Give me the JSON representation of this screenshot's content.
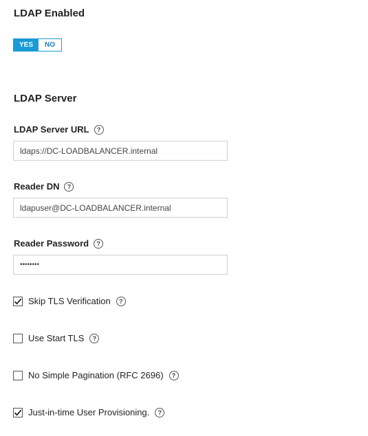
{
  "ldap_enabled": {
    "title": "LDAP Enabled",
    "toggle": {
      "yes_label": "YES",
      "no_label": "NO",
      "selected": "YES"
    }
  },
  "ldap_server": {
    "title": "LDAP Server",
    "server_url": {
      "label": "LDAP Server URL",
      "value": "ldaps://DC-LOADBALANCER.internal"
    },
    "reader_dn": {
      "label": "Reader DN",
      "value": "ldapuser@DC-LOADBALANCER.internal"
    },
    "reader_password": {
      "label": "Reader Password",
      "value": "••••••••"
    }
  },
  "options": [
    {
      "label": "Skip TLS Verification",
      "checked": true
    },
    {
      "label": "Use Start TLS",
      "checked": false
    },
    {
      "label": "No Simple Pagination (RFC 2696)",
      "checked": false
    },
    {
      "label": "Just-in-time User Provisioning.",
      "checked": true
    }
  ],
  "help_glyph": "?",
  "colors": {
    "accent": "#1a9ad6"
  }
}
